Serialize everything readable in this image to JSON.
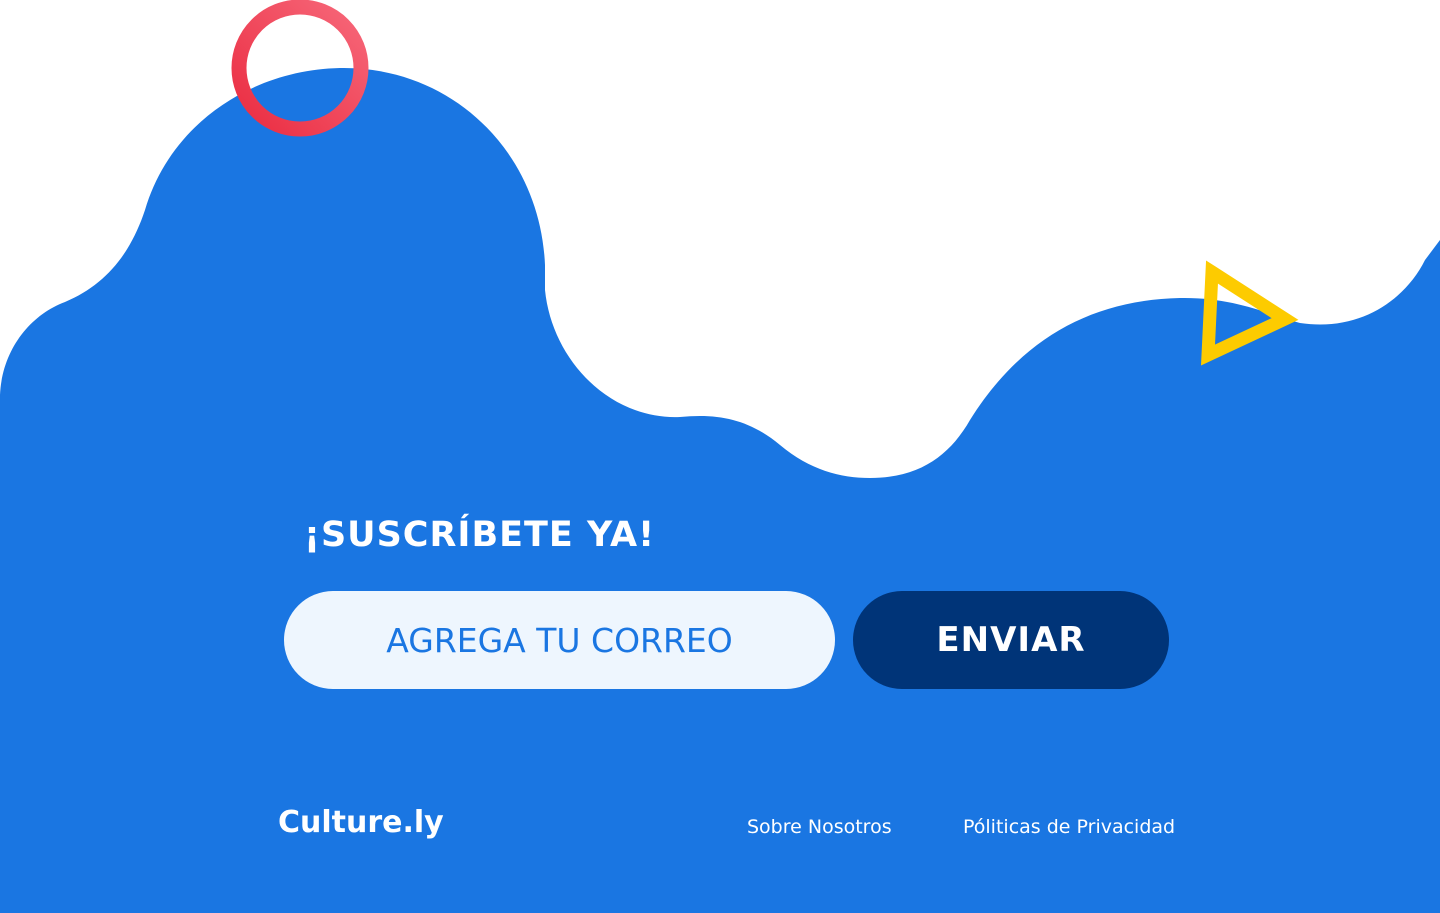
{
  "subscribe": {
    "title": "¡SUSCRÍBETE YA!",
    "email_placeholder": "AGREGA TU CORREO",
    "submit_label": "ENVIAR"
  },
  "footer": {
    "brand": "Culture.ly",
    "links": [
      {
        "label": "Sobre Nosotros"
      },
      {
        "label": "Póliticas de Privacidad"
      }
    ]
  },
  "decorations": {
    "circle_color": "#f04b5c",
    "triangle_color": "#fdcb00"
  },
  "colors": {
    "primary_blue": "#1a76e2",
    "dark_blue": "#003478",
    "input_background": "#eef6fe",
    "text_light": "#ffffff"
  },
  "icons": [
    "ring-shape-icon",
    "triangle-outline-icon"
  ]
}
